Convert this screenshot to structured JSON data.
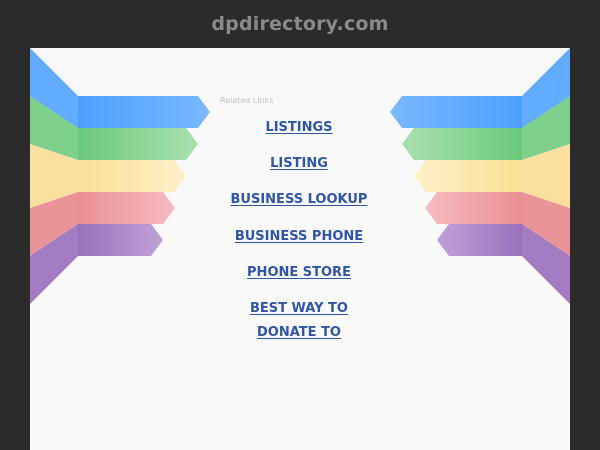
{
  "header": {
    "domain": "dpdirectory.com"
  },
  "related": {
    "heading": "Related Links",
    "links": [
      "LISTINGS",
      "LISTING",
      "BUSINESS LOOKUP",
      "BUSINESS PHONE",
      "PHONE STORE",
      "BEST WAY TO",
      "DONATE TO"
    ]
  },
  "colors": {
    "background": "#2b2b2b",
    "panel": "#f9f9f9",
    "link": "#2f56a6",
    "ribbons": [
      "#5aa8ff",
      "#7fd08a",
      "#fde6a4",
      "#ef9da1",
      "#a77fc4"
    ]
  }
}
